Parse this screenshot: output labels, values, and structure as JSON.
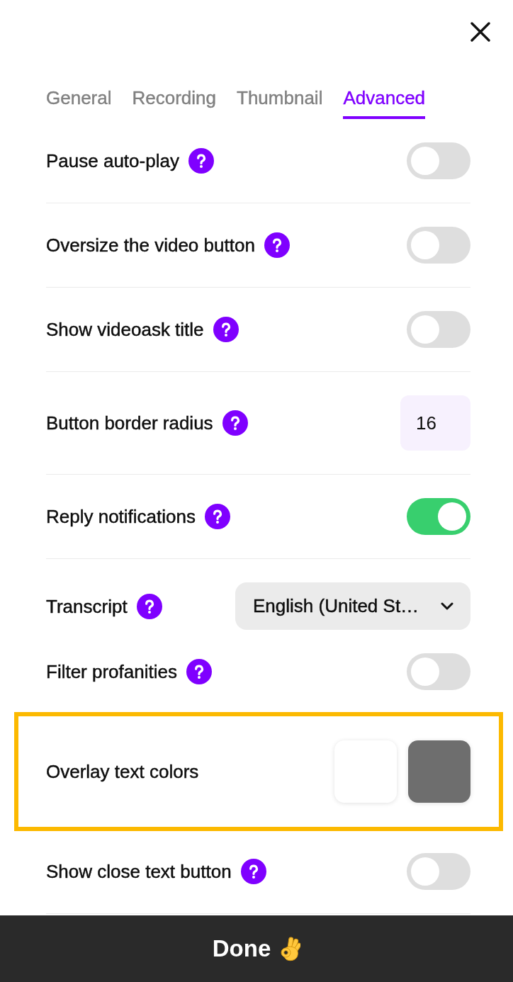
{
  "tabs": [
    {
      "label": "General",
      "selected": false
    },
    {
      "label": "Recording",
      "selected": false
    },
    {
      "label": "Thumbnail",
      "selected": false
    },
    {
      "label": "Advanced",
      "selected": true
    }
  ],
  "sections": [
    {
      "rows": [
        {
          "kind": "toggle",
          "label": "Pause auto-play",
          "help": true,
          "on": false,
          "highlighted": false
        }
      ]
    },
    {
      "rows": [
        {
          "kind": "toggle",
          "label": "Oversize the video button",
          "help": true,
          "on": false,
          "highlighted": false
        }
      ]
    },
    {
      "rows": [
        {
          "kind": "toggle",
          "label": "Show videoask title",
          "help": true,
          "on": false,
          "highlighted": false
        }
      ]
    },
    {
      "rows": [
        {
          "kind": "number",
          "label": "Button border radius",
          "help": true,
          "value": "16",
          "highlighted": false
        }
      ]
    },
    {
      "rows": [
        {
          "kind": "toggle",
          "label": "Reply notifications",
          "help": true,
          "on": true,
          "highlighted": false
        }
      ]
    },
    {
      "rows": [
        {
          "kind": "select",
          "label": "Transcript",
          "help": true,
          "value": "English (United St…",
          "highlighted": false
        },
        {
          "kind": "toggle",
          "label": "Filter profanities",
          "help": true,
          "on": false,
          "highlighted": false
        }
      ]
    },
    {
      "rows": [
        {
          "kind": "colors",
          "label": "Overlay text colors",
          "help": false,
          "swatches": [
            {
              "color": "#ffffff"
            },
            {
              "color": "#6e6e6e"
            }
          ],
          "highlighted": true
        }
      ]
    },
    {
      "rows": [
        {
          "kind": "toggle",
          "label": "Show close text button",
          "help": true,
          "on": false,
          "highlighted": false
        }
      ]
    }
  ],
  "footer": {
    "button": "Done"
  }
}
